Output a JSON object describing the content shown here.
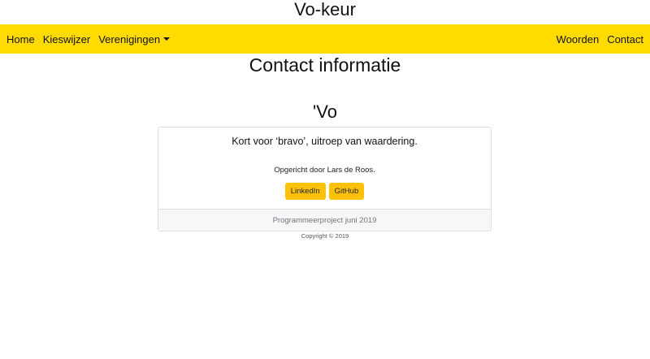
{
  "site": {
    "title": "Vo-keur"
  },
  "nav": {
    "left": [
      {
        "label": "Home"
      },
      {
        "label": "Kieswijzer"
      },
      {
        "label": "Verenigingen"
      }
    ],
    "right": [
      {
        "label": "Woorden"
      },
      {
        "label": "Contact"
      }
    ],
    "accent_color": "#ffdb00"
  },
  "main": {
    "heading": "Contact informatie",
    "brand_heading": "'Vo",
    "card": {
      "title": "Kort voor ‘bravo’, uitroep van waardering.",
      "text": "Opgericht door Lars de Roos.",
      "buttons": [
        {
          "label": "LinkedIn"
        },
        {
          "label": "GitHub"
        }
      ],
      "button_color": "#ffc107",
      "footer": "Programmeerproject juni 2019"
    },
    "copyright": "Copyright © 2019"
  }
}
